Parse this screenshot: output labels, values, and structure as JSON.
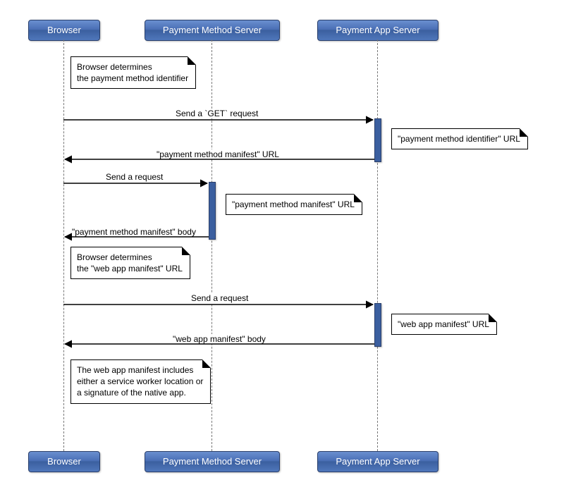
{
  "actors": {
    "browser": "Browser",
    "pms": "Payment Method Server",
    "pas": "Payment App Server"
  },
  "notes": {
    "n1_l1": "Browser determines",
    "n1_l2": "the payment method identifier",
    "n2": "\"payment method identifier\" URL",
    "n3": "\"payment method manifest\" URL",
    "n4_l1": "Browser determines",
    "n4_l2": "the \"web app manifest\" URL",
    "n5": "\"web app manifest\" URL",
    "n6_l1": "The web app manifest includes",
    "n6_l2": "either a service worker location or",
    "n6_l3": "a signature of the native app."
  },
  "labels": {
    "m1": "Send a `GET` request",
    "m2": "\"payment method manifest\" URL",
    "m3": "Send a request",
    "m4": "\"payment method manifest\" body",
    "m5": "Send a request",
    "m6": "\"web app manifest\" body"
  }
}
